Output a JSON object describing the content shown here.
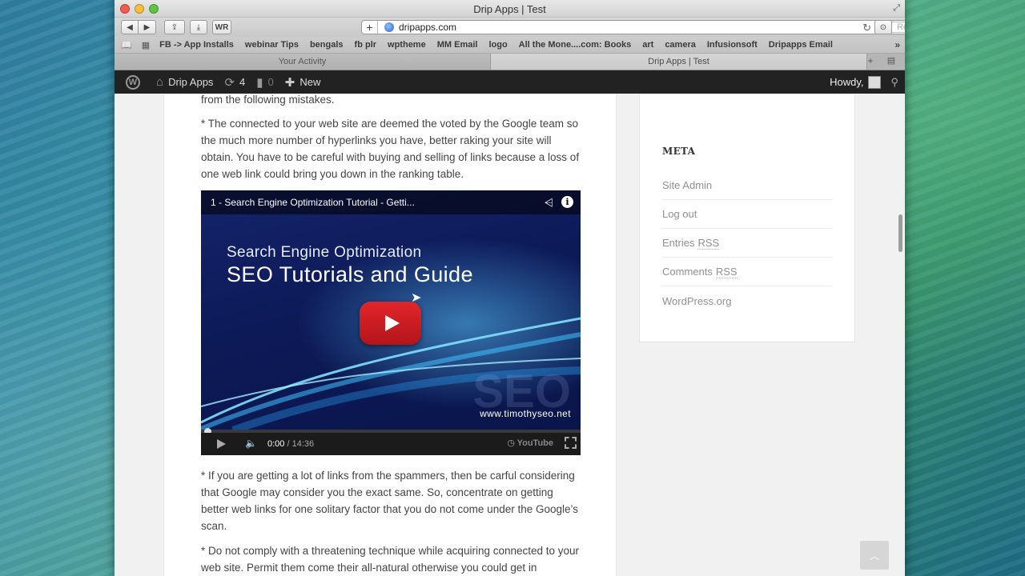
{
  "window": {
    "title": "Drip Apps | Test"
  },
  "toolbar": {
    "url": "dripapps.com",
    "reader_label": "Reader",
    "wr_label": "WR"
  },
  "bookmarks": [
    "FB -> App Installs",
    "webinar Tips",
    "bengals",
    "fb plr",
    "wptheme",
    "MM Email",
    "logo",
    "All the Mone....com: Books",
    "art",
    "camera",
    "Infusionsoft",
    "Dripapps Email"
  ],
  "tabs": [
    {
      "label": "Your Activity",
      "active": false
    },
    {
      "label": "Drip Apps | Test",
      "active": true
    }
  ],
  "adminbar": {
    "site_name": "Drip Apps",
    "updates_count": "4",
    "comments_count": "0",
    "new_label": "New",
    "howdy": "Howdy,"
  },
  "post": {
    "p0": "from the following mistakes.",
    "p1": "* The connected to your web site are deemed the voted by the Google team so the much more number of hyperlinks you have, better raking your site will obtain. You have to be careful with buying and selling of links because a loss of one web link could bring you down in the ranking table.",
    "p2": "* If you are getting a lot of links from the spammers, then be carful considering that Google may consider you the exact same. So, concentrate on getting better web links for one solitary factor that you do not come under the Google’s scan.",
    "p3": "* Do not comply with a threatening technique while acquiring connected to your web site. Permit them come their all-natural otherwise you could get in"
  },
  "video": {
    "title": "1 - Search Engine Optimization Tutorial - Getti...",
    "subtitle": "Search Engine Optimization",
    "headline": "SEO Tutorials and Guide",
    "watermark": "SEO",
    "site": "www.timothyseo.net",
    "current_time": "0:00",
    "duration": "/ 14:36",
    "youtube_label": "YouTube",
    "progress": 0
  },
  "sidebar": {
    "meta_title": "META",
    "links": [
      {
        "label": "Site Admin",
        "abbr": ""
      },
      {
        "label": "Log out",
        "abbr": ""
      },
      {
        "label": "Entries",
        "abbr": "RSS"
      },
      {
        "label": "Comments",
        "abbr": "RSS"
      },
      {
        "label": "WordPress.org",
        "abbr": ""
      }
    ]
  },
  "colors": {
    "adminbar_bg": "#222222",
    "play_button": "#e2262a",
    "link_gray": "#909090"
  },
  "icons": [
    "wordpress-icon",
    "home-icon",
    "updates-icon",
    "comment-icon",
    "plus-icon",
    "search-icon",
    "share-icon",
    "info-icon",
    "volume-icon",
    "fullscreen-icon",
    "back-to-top-icon"
  ]
}
